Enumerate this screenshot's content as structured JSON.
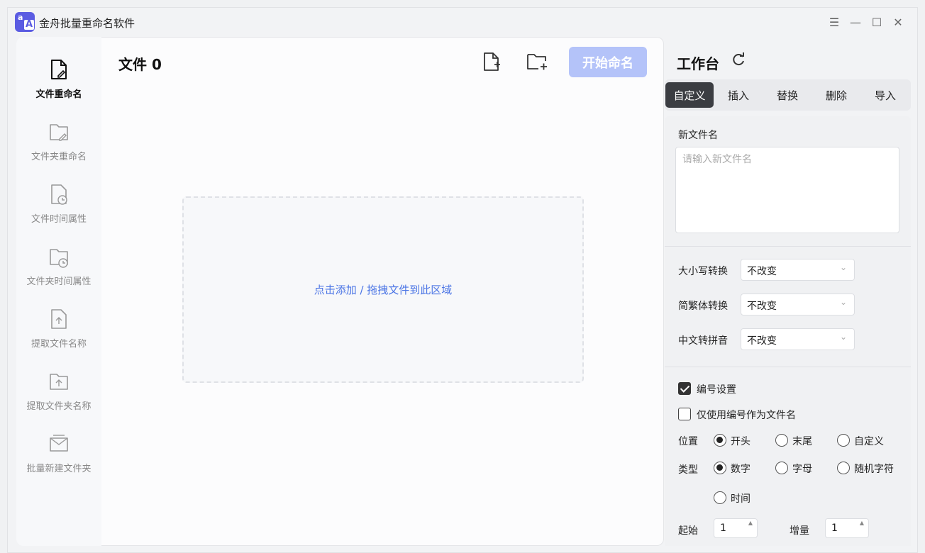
{
  "app": {
    "title": "金舟批量重命名软件",
    "logo_small": "a",
    "logo_big": "A"
  },
  "window_controls": {
    "menu": "☰",
    "minimize": "—",
    "maximize": "☐",
    "close": "✕"
  },
  "sidebar": {
    "items": [
      {
        "label": "文件重命名",
        "icon": "file-edit-icon",
        "active": true
      },
      {
        "label": "文件夹重命名",
        "icon": "folder-edit-icon",
        "active": false
      },
      {
        "label": "文件时间属性",
        "icon": "file-clock-icon",
        "active": false
      },
      {
        "label": "文件夹时间属性",
        "icon": "folder-clock-icon",
        "active": false
      },
      {
        "label": "提取文件名称",
        "icon": "file-upload-icon",
        "active": false
      },
      {
        "label": "提取文件夹名称",
        "icon": "folder-upload-icon",
        "active": false
      },
      {
        "label": "批量新建文件夹",
        "icon": "new-folder-envelope-icon",
        "active": false
      }
    ]
  },
  "main": {
    "title": "文件 0",
    "start_button": "开始命名",
    "dropzone_text": "点击添加 / 拖拽文件到此区域"
  },
  "workspace": {
    "title": "工作台",
    "tabs": [
      "自定义",
      "插入",
      "替换",
      "删除",
      "导入"
    ],
    "active_tab": "自定义",
    "new_name_label": "新文件名",
    "new_name_placeholder": "请输入新文件名",
    "case_label": "大小写转换",
    "case_value": "不改变",
    "trad_label": "简繁体转换",
    "trad_value": "不改变",
    "pinyin_label": "中文转拼音",
    "pinyin_value": "不改变",
    "numbering_label": "编号设置",
    "numbering_checked": true,
    "only_number_label": "仅使用编号作为文件名",
    "only_number_checked": false,
    "position_label": "位置",
    "position_options": [
      "开头",
      "末尾",
      "自定义"
    ],
    "position_selected": "开头",
    "type_label": "类型",
    "type_options": [
      "数字",
      "字母",
      "随机字符",
      "时间"
    ],
    "type_selected": "数字",
    "start_label": "起始",
    "start_value": "1",
    "step_label": "增量",
    "step_value": "1"
  },
  "colors": {
    "accent": "#5b5ce2",
    "start_button": "#b4c3f9",
    "link": "#4a74e5",
    "active_tab": "#3b3d42"
  }
}
